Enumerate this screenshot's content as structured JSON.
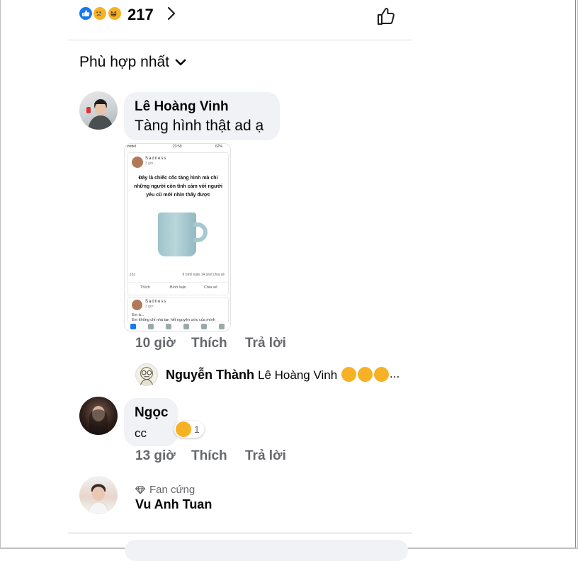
{
  "reactions": {
    "count": "217",
    "types": [
      "like-icon",
      "sad-icon",
      "haha-icon"
    ],
    "colors": {
      "like": "#1877f2",
      "emoji": "#f7b125"
    }
  },
  "sort": {
    "label": "Phù hợp nhất"
  },
  "comments": [
    {
      "name": "Lê Hoàng Vinh",
      "text": "Tàng hình thật ad ạ",
      "time": "10 giờ",
      "like_label": "Thích",
      "reply_label": "Trả lời",
      "attachment": {
        "status_carrier": "viettel",
        "status_time": "23:59",
        "status_battery": "62%",
        "page_name": "Sadness",
        "post_time": "3 giờ · ",
        "caption": "Đây là chiếc cốc tàng hình mà chỉ những người còn tình cảm với người yêu cũ mới nhìn thấy được",
        "reaction_count": "161",
        "comment_count": "9 bình luận",
        "share_count": "14 lượt chia sẻ",
        "like_action": "Thích",
        "comment_action": "Bình luận",
        "share_action": "Chia sẻ",
        "next_page_name": "Sadness",
        "next_post_time": "3 giờ · ",
        "next_post_line1": "Em à...",
        "next_post_line2": "Em không chỉ nhà tan hết nguyện ước của mình"
      },
      "reply_preview": {
        "name": "Nguyễn Thành",
        "text": "Lê Hoàng Vinh",
        "ellipsis": "..."
      }
    },
    {
      "name": "Ngọc",
      "text": "cc",
      "time": "13 giờ",
      "like_label": "Thích",
      "reply_label": "Trả lời",
      "reaction_count": "1"
    },
    {
      "badge": "Fan cứng",
      "name": "Vu Anh Tuan"
    }
  ]
}
